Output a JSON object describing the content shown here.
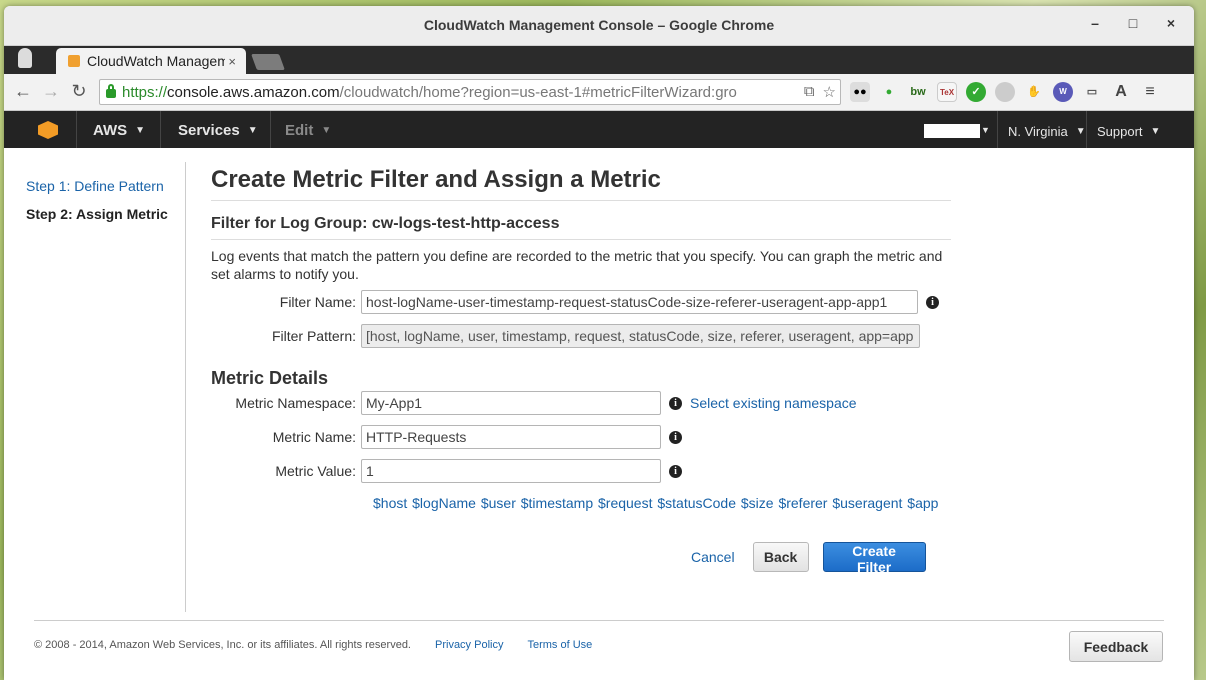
{
  "window": {
    "title": "CloudWatch Management Console – Google Chrome",
    "controls": [
      "–",
      "□",
      "×"
    ]
  },
  "tab": {
    "label": "CloudWatch Management Console",
    "close": "×"
  },
  "toolbar": {
    "url_scheme": "https://",
    "url_host": "console.aws.amazon.com",
    "url_rest": "/cloudwatch/home?region=us-east-1#metricFilterWizard:gro",
    "extensions": [
      "bw",
      "TeX"
    ]
  },
  "awsbar": {
    "aws_label": "AWS",
    "services_label": "Services",
    "edit_label": "Edit",
    "region_label": "N. Virginia",
    "support_label": "Support"
  },
  "nav": {
    "step1": "Step 1: Define Pattern",
    "step2": "Step 2: Assign Metric"
  },
  "page": {
    "title": "Create Metric Filter and Assign a Metric",
    "subtitle": "Filter for Log Group: cw-logs-test-http-access",
    "description": "Log events that match the pattern you define are recorded to the metric that you specify. You can graph the metric and set alarms to notify you."
  },
  "form": {
    "filter_name_label": "Filter Name:",
    "filter_name_value": "host-logName-user-timestamp-request-statusCode-size-referer-useragent-app-app1",
    "filter_pattern_label": "Filter Pattern:",
    "filter_pattern_value": "[host, logName, user, timestamp, request, statusCode, size, referer, useragent, app=app",
    "metric_details_heading": "Metric Details",
    "namespace_label": "Metric Namespace:",
    "namespace_value": "My-App1",
    "select_namespace_link": "Select existing namespace",
    "metric_name_label": "Metric Name:",
    "metric_name_value": "HTTP-Requests",
    "metric_value_label": "Metric Value:",
    "metric_value_value": "1",
    "tokens": "$host $logName $user $timestamp $request $statusCode $size $referer $useragent $app",
    "info_glyph": "i"
  },
  "buttons": {
    "cancel": "Cancel",
    "back": "Back",
    "create": "Create Filter",
    "feedback": "Feedback"
  },
  "footer": {
    "copyright": "© 2008 - 2014, Amazon Web Services, Inc. or its affiliates. All rights reserved.",
    "privacy": "Privacy Policy",
    "terms": "Terms of Use"
  },
  "colors": {
    "link": "#1a63a8",
    "primary_button": "#1c6cc8",
    "aws_bar": "#232323",
    "aws_orange": "#f39c26"
  }
}
